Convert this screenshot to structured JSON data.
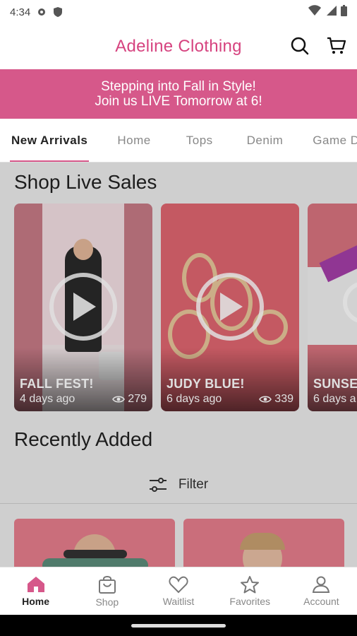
{
  "status": {
    "time": "4:34"
  },
  "header": {
    "brand": "Adeline Clothing"
  },
  "banner": {
    "line1": "Stepping into Fall in Style!",
    "line2": "Join us LIVE Tomorrow at 6!"
  },
  "tabs": [
    "New Arrivals",
    "Home",
    "Tops",
    "Denim",
    "Game Da"
  ],
  "live": {
    "title": "Shop Live Sales",
    "cards": [
      {
        "title": "FALL FEST!",
        "age": "4 days ago",
        "views": "279"
      },
      {
        "title": "JUDY BLUE!",
        "age": "6 days ago",
        "views": "339"
      },
      {
        "title": "SUNSE",
        "age": "6 days a",
        "views": ""
      }
    ]
  },
  "recent": {
    "title": "Recently Added",
    "filter_label": "Filter"
  },
  "nav": [
    {
      "label": "Home",
      "icon": "home-icon",
      "active": true
    },
    {
      "label": "Shop",
      "icon": "shopping-bag-icon",
      "active": false
    },
    {
      "label": "Waitlist",
      "icon": "heart-icon",
      "active": false
    },
    {
      "label": "Favorites",
      "icon": "star-icon",
      "active": false
    },
    {
      "label": "Account",
      "icon": "person-icon",
      "active": false
    }
  ],
  "colors": {
    "brand": "#d6437f",
    "banner": "#d6588a",
    "nav_active": "#d6588a"
  }
}
